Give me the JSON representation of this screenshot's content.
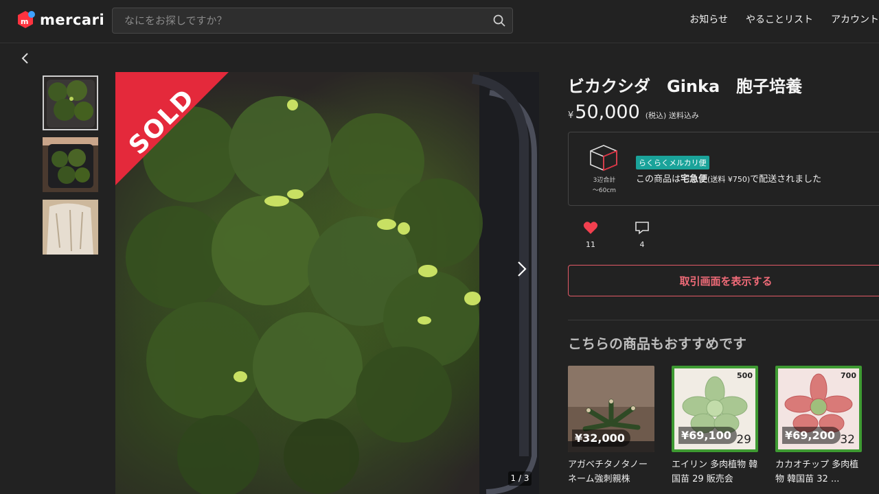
{
  "header": {
    "logo_text": "mercari",
    "search_placeholder": "なにをお探しですか？",
    "nav": [
      "お知らせ",
      "やることリスト",
      "アカウント"
    ]
  },
  "gallery": {
    "sold_label": "SOLD",
    "counter": "1 / 3",
    "thumbnail_count": 3,
    "active_thumbnail": 1
  },
  "item": {
    "title": "ビカクシダ　Ginka　胞子培養",
    "currency": "¥",
    "price": "50,000",
    "price_note": "(税込) 送料込み"
  },
  "shipping": {
    "size_caption_1": "3辺合計",
    "size_caption_2": "〜60cm",
    "badge": "らくらくメルカリ便",
    "text_prefix": "この商品は",
    "method": "宅急便",
    "fee": "(送料 ¥750)",
    "text_suffix": "で配送されました"
  },
  "actions": {
    "likes": "11",
    "comments": "4",
    "trade_button": "取引画面を表示する"
  },
  "recommendations": {
    "title": "こちらの商品もおすすめです",
    "items": [
      {
        "price": "¥32,000",
        "name": "アガベチタノタノーネーム強刺親株",
        "tag": "",
        "num": ""
      },
      {
        "price": "¥69,100",
        "name": "エイリン 多肉植物 韓国苗 29 販売会",
        "tag": "500",
        "num": "29"
      },
      {
        "price": "¥69,200",
        "name": "カカオチップ 多肉植物 韓国苗 32 ...",
        "tag": "700",
        "num": "32"
      }
    ]
  },
  "colors": {
    "accent_red": "#e4293b",
    "badge_teal": "#1aa39a",
    "card_green_border": "#3e9a32"
  }
}
